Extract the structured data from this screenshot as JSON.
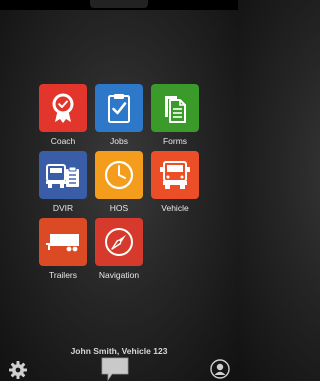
{
  "apps": [
    {
      "label": "Coach",
      "icon": "badge-ribbon-icon",
      "color": "#e2352b"
    },
    {
      "label": "Jobs",
      "icon": "clipboard-check-icon",
      "color": "#2d78c8"
    },
    {
      "label": "Forms",
      "icon": "documents-icon",
      "color": "#3a9a2a"
    },
    {
      "label": "DVIR",
      "icon": "truck-clipboard-icon",
      "color": "#3a5da8"
    },
    {
      "label": "HOS",
      "icon": "clock-icon",
      "color": "#f49d1c"
    },
    {
      "label": "Vehicle",
      "icon": "truck-front-icon",
      "color": "#ec4e27"
    },
    {
      "label": "Trailers",
      "icon": "trailer-icon",
      "color": "#db4a24"
    },
    {
      "label": "Navigation",
      "icon": "compass-icon",
      "color": "#d63a2c"
    }
  ],
  "footer": {
    "user_label": "John Smith, Vehicle 123",
    "settings_icon": "gear-icon",
    "messages_icon": "chat-bubble-icon",
    "profile_icon": "user-icon"
  }
}
